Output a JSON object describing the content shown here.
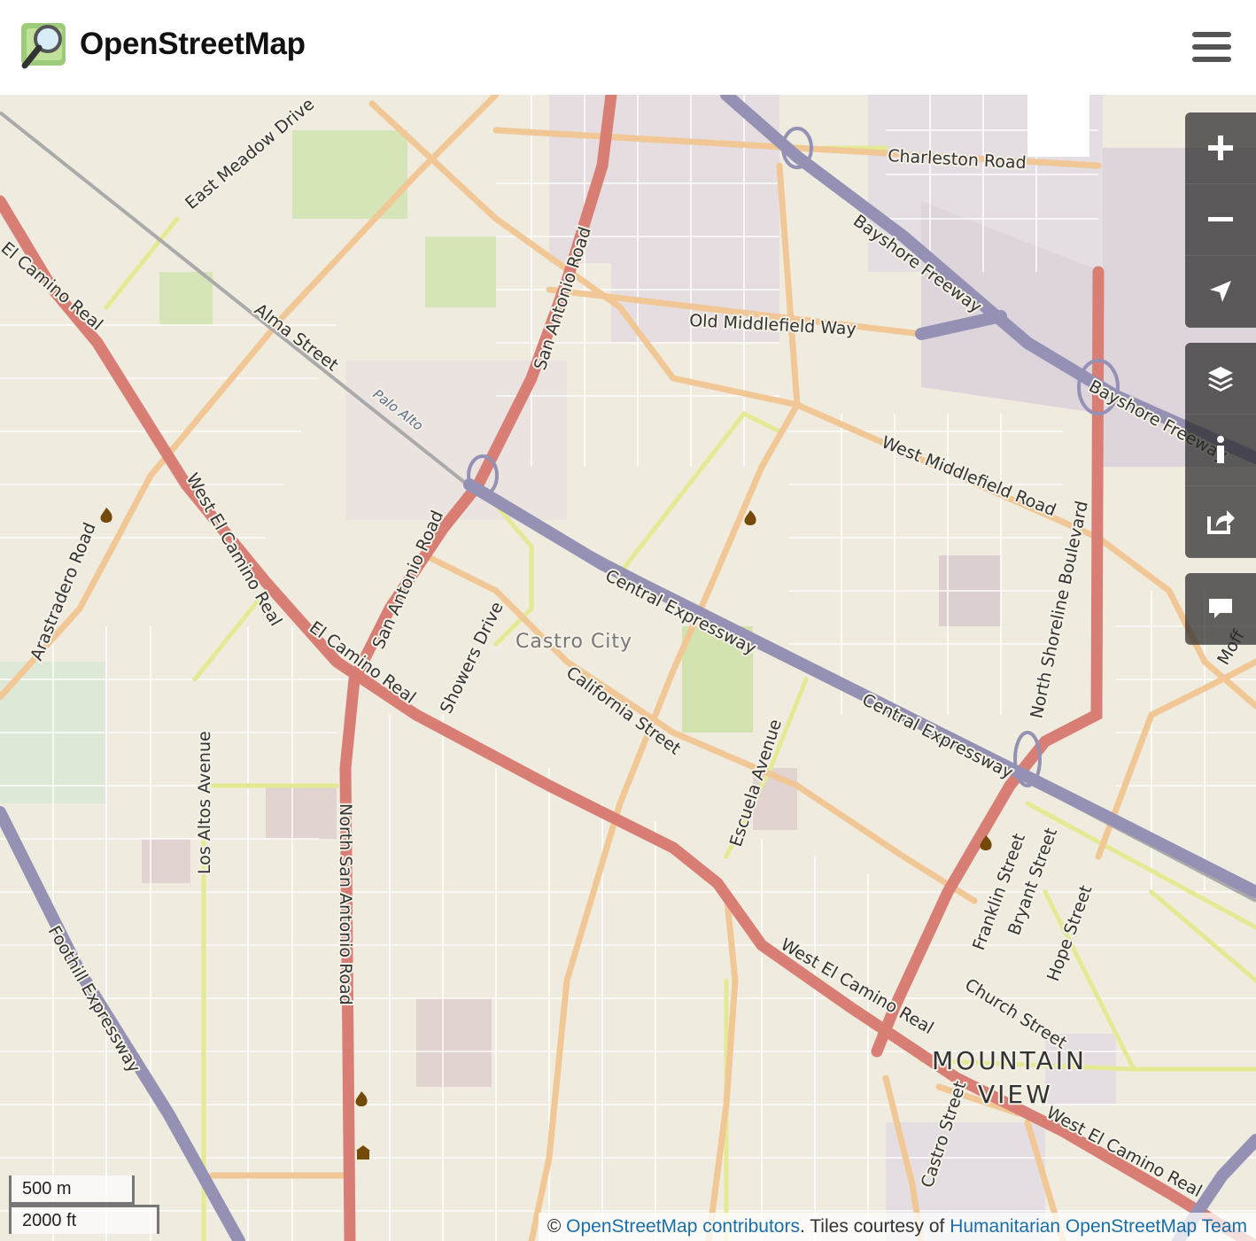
{
  "header": {
    "brand": "OpenStreetMap",
    "menu_icon": "hamburger-menu-icon"
  },
  "map": {
    "place_labels": {
      "castro_city": "Castro City",
      "mountain_view_1": "MOUNTAIN",
      "mountain_view_2": "VIEW",
      "palo_alto": "Palo Alto"
    },
    "streets": {
      "east_meadow": "East Meadow Drive",
      "charleston": "Charleston Road",
      "bayshore1": "Bayshore Freeway",
      "bayshore2": "Bayshore Freeway",
      "old_middlefield": "Old Middlefield Way",
      "west_middlefield": "West Middlefield Road",
      "san_antonio1": "San Antonio Road",
      "san_antonio2": "San Antonio Road",
      "north_san_antonio": "North San Antonio Road",
      "alma": "Alma Street",
      "el_camino_nw": "El Camino Real",
      "west_el_camino1": "West El Camino Real",
      "el_camino_mid": "El Camino Real",
      "west_el_camino2": "West El Camino Real",
      "west_el_camino3": "West El Camino Real",
      "arastradero": "Arastradero Road",
      "central1": "Central Expressway",
      "central2": "Central Expressway",
      "showers": "Showers Drive",
      "california": "California Street",
      "escuela": "Escuela Avenue",
      "north_shoreline": "North Shoreline Boulevard",
      "los_altos": "Los Altos Avenue",
      "foothill": "Foothill Expressway",
      "franklin": "Franklin Street",
      "bryant": "Bryant Street",
      "hope": "Hope Street",
      "church": "Church Street",
      "castro": "Castro Street",
      "moff": "Moff"
    },
    "icons": [
      "fire-station-icon",
      "fire-station-icon",
      "fire-station-icon",
      "fire-station-icon",
      "fire-station-icon",
      "town-hall-icon"
    ]
  },
  "controls": {
    "zoom_in": "zoom-in-icon",
    "zoom_out": "zoom-out-icon",
    "locate": "location-arrow-icon",
    "layers": "layers-icon",
    "info": "info-icon",
    "share": "share-icon",
    "note": "note-comment-icon"
  },
  "scale": {
    "metric": "500 m",
    "imperial": "2000 ft"
  },
  "attribution": {
    "prefix": "© ",
    "osm_link": "OpenStreetMap contributors",
    "middle": ". Tiles courtesy of ",
    "hot_link": "Humanitarian OpenStreetMap Team"
  }
}
